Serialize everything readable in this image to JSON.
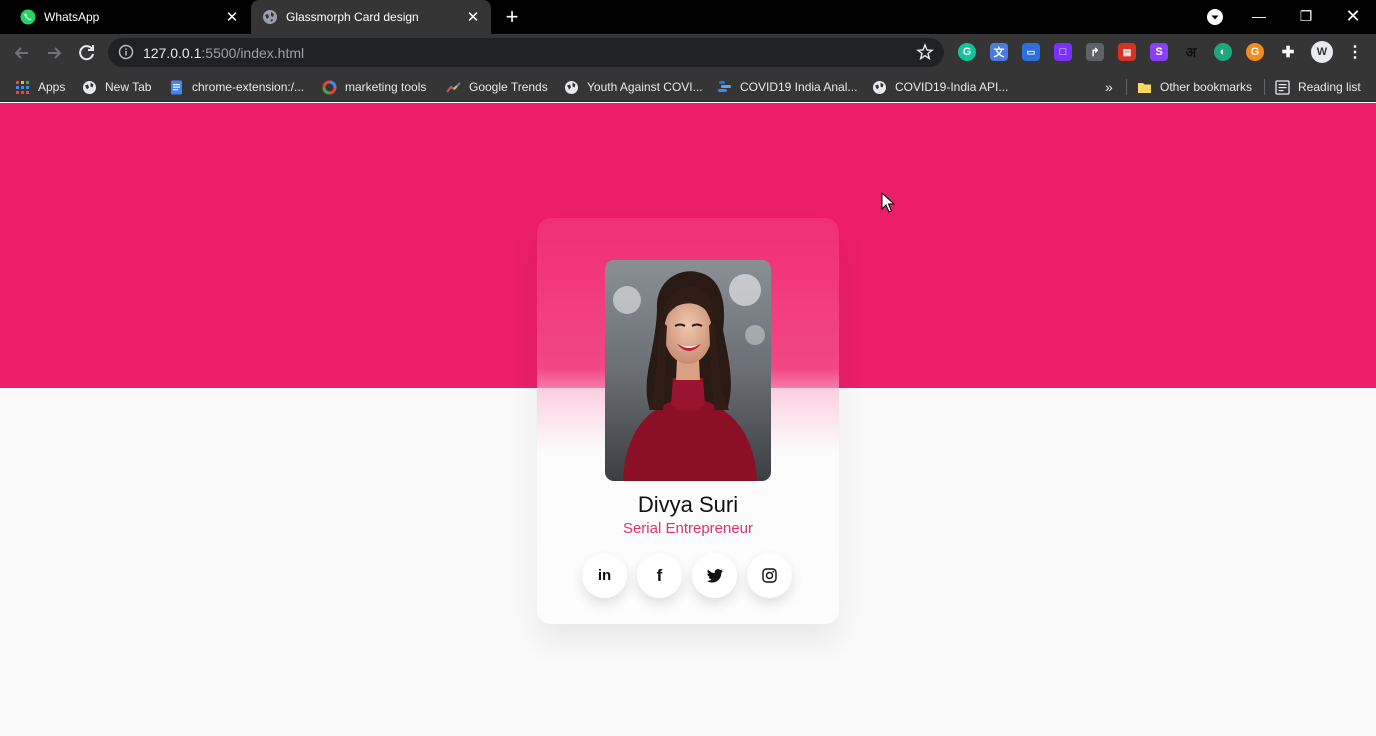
{
  "tabs": [
    {
      "label": "WhatsApp",
      "active": false,
      "icon": "whatsapp-icon"
    },
    {
      "label": "Glassmorph Card design",
      "active": true,
      "icon": "globe-icon"
    }
  ],
  "address_bar": {
    "host": "127.0.0.1",
    "path": ":5500/index.html"
  },
  "bookmarks": [
    {
      "label": "Apps",
      "icon": "apps-grid-icon"
    },
    {
      "label": "New Tab",
      "icon": "globe-icon"
    },
    {
      "label": "chrome-extension:/...",
      "icon": "doc-icon"
    },
    {
      "label": "marketing tools",
      "icon": "google-icon"
    },
    {
      "label": "Google Trends",
      "icon": "trends-icon"
    },
    {
      "label": "Youth Against COVI...",
      "icon": "globe-icon"
    },
    {
      "label": "COVID19 India Anal...",
      "icon": "analytics-icon"
    },
    {
      "label": "COVID19-India API...",
      "icon": "globe-icon"
    }
  ],
  "bookmarks_overflow": "»",
  "other_bookmarks": "Other bookmarks",
  "reading_list": "Reading list",
  "profile": {
    "name": "Divya Suri",
    "title": "Serial Entrepreneur"
  },
  "socials": [
    {
      "label": "in",
      "network": "linkedin"
    },
    {
      "label": "f",
      "network": "facebook"
    },
    {
      "label": "twitter",
      "network": "twitter"
    },
    {
      "label": "instagram",
      "network": "instagram"
    }
  ],
  "colors": {
    "hero": "#ec1e6a",
    "accent": "#e2306c",
    "background": "#fafafa"
  }
}
